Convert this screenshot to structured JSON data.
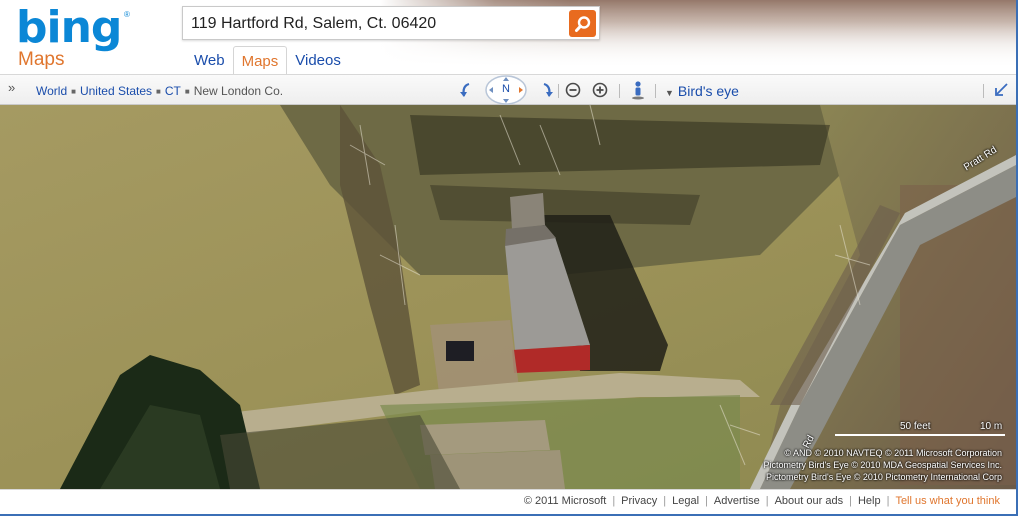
{
  "brand": {
    "logo_text": "bing",
    "vertical": "Maps"
  },
  "search": {
    "value": "119 Hartford Rd, Salem, Ct. 06420"
  },
  "tabs": [
    {
      "label": "Web",
      "active": false
    },
    {
      "label": "Maps",
      "active": true
    },
    {
      "label": "Videos",
      "active": false
    }
  ],
  "toolbar": {
    "breadcrumb": [
      "World",
      "United States",
      "CT",
      "New London Co."
    ],
    "compass_label": "N",
    "view_mode": "Bird's eye"
  },
  "map": {
    "road_label_1": "Pratt Rd",
    "road_label_2": "Rd",
    "scale_feet": "50 feet",
    "scale_meters": "10 m",
    "copyright": [
      "© AND   © 2010 NAVTEQ   © 2011 Microsoft Corporation",
      "Pictometry Bird's Eye © 2010 MDA Geospatial Services Inc.",
      "Pictometry Bird's Eye © 2010 Pictometry International Corp"
    ]
  },
  "footer": {
    "copyright": "© 2011 Microsoft",
    "links": [
      "Privacy",
      "Legal",
      "Advertise",
      "About our ads",
      "Help"
    ],
    "feedback": "Tell us what you think"
  },
  "colors": {
    "brand_blue": "#0b87d6",
    "accent_orange": "#e0762e",
    "link_blue": "#1a4dab"
  }
}
